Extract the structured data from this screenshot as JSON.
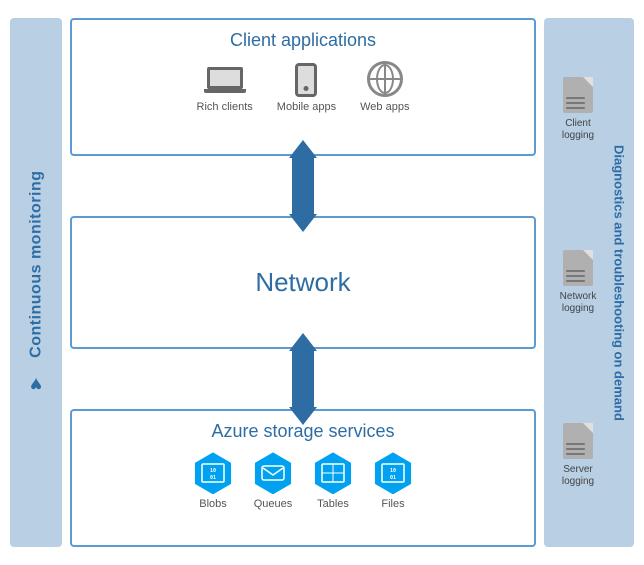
{
  "left_sidebar": {
    "label": "Continuous monitoring",
    "heart_symbol": "♥"
  },
  "client_apps": {
    "title": "Client applications",
    "icons": [
      {
        "id": "rich-clients",
        "label": "Rich clients"
      },
      {
        "id": "mobile-apps",
        "label": "Mobile apps"
      },
      {
        "id": "web-apps",
        "label": "Web apps"
      }
    ]
  },
  "network": {
    "title": "Network"
  },
  "azure_storage": {
    "title": "Azure storage services",
    "icons": [
      {
        "id": "blobs",
        "label": "Blobs",
        "text": "10\n01"
      },
      {
        "id": "queues",
        "label": "Queues",
        "text": "✉"
      },
      {
        "id": "tables",
        "label": "Tables",
        "text": "⊞"
      },
      {
        "id": "files",
        "label": "Files",
        "text": "10\n01"
      }
    ]
  },
  "right_sidebar": {
    "label1": "Diagnostics and troubleshooting",
    "label2": "on demand",
    "logs": [
      {
        "id": "client-logging",
        "label": "Client\nlogging"
      },
      {
        "id": "network-logging",
        "label": "Network\nlogging"
      },
      {
        "id": "server-logging",
        "label": "Server\nlogging"
      }
    ]
  }
}
